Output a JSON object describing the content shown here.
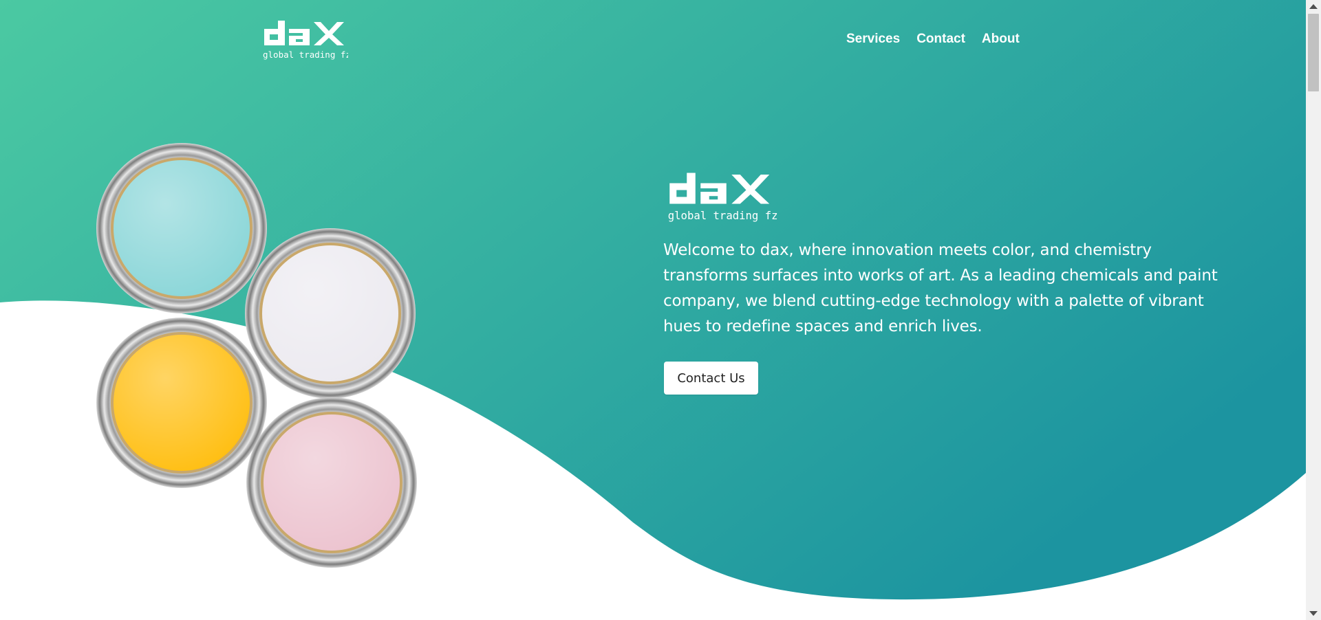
{
  "brand": {
    "name": "dax",
    "tagline": "global trading fze",
    "logo_color": "#ffffff"
  },
  "nav": {
    "items": [
      {
        "label": "Services"
      },
      {
        "label": "Contact"
      },
      {
        "label": "About"
      }
    ]
  },
  "hero": {
    "description": "Welcome to dax, where innovation meets color, and chemistry transforms surfaces into works of art. As a leading chemicals and paint company, we blend cutting-edge technology with a palette of vibrant hues to redefine spaces and enrich lives.",
    "cta_label": "Contact Us",
    "gradient_colors": [
      "#4bc9a2",
      "#1c94a0"
    ],
    "paint_colors": [
      "#8ad6d8",
      "#eceaf0",
      "#ffbe10",
      "#ecc3cf"
    ]
  }
}
